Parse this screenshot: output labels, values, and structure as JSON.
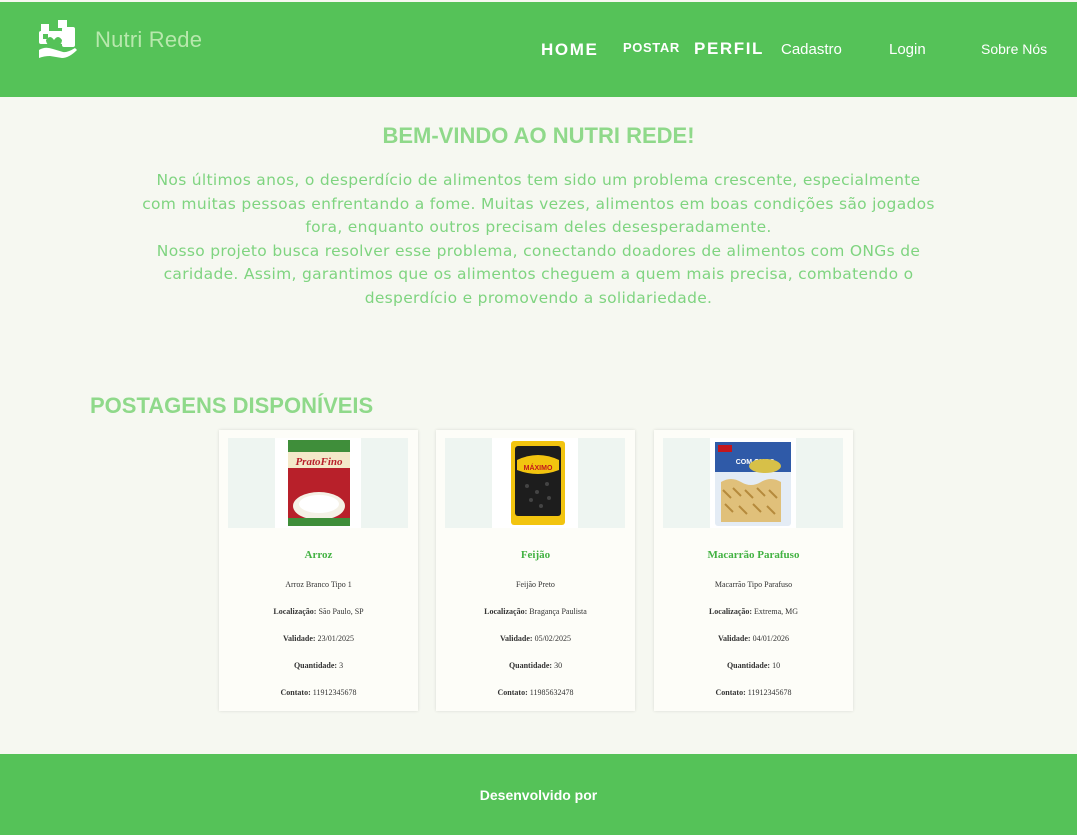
{
  "header": {
    "brand": "Nutri Rede",
    "logo_icon": "hands-heart-icon",
    "nav": {
      "home": "HOME",
      "postar": "POSTAR",
      "perfil": "PERFIL",
      "cadastro": "Cadastro",
      "login": "Login",
      "sobre": "Sobre Nós"
    }
  },
  "welcome": {
    "title": "BEM-VINDO AO NUTRI REDE!",
    "paragraph1": "Nos últimos anos, o desperdício de alimentos tem sido um problema crescente, especialmente com muitas pessoas enfrentando a fome. Muitas vezes, alimentos em boas condições são jogados fora, enquanto outros precisam deles desesperadamente.",
    "paragraph2": "Nosso projeto busca resolver esse problema, conectando doadores de alimentos com ONGs de caridade. Assim, garantimos que os alimentos cheguem a quem mais precisa, combatendo o desperdício e promovendo a solidariedade."
  },
  "posts": {
    "title": "POSTAGENS DISPONÍVEIS",
    "labels": {
      "localizacao": "Localização:",
      "validade": "Validade:",
      "quantidade": "Quantidade:",
      "contato": "Contato:"
    },
    "items": [
      {
        "name": "Arroz",
        "description": "Arroz Branco Tipo 1",
        "location": "São Paulo, SP",
        "validity": "23/01/2025",
        "quantity": "3",
        "contact": "11912345678",
        "image_brand": "PratoFino",
        "image_icon": "rice-package-image"
      },
      {
        "name": "Feijão",
        "description": "Feijão Preto",
        "location": "Bragança Paulista",
        "validity": "05/02/2025",
        "quantity": "30",
        "contact": "11985632478",
        "image_brand": "MÁXIMO",
        "image_icon": "black-beans-package-image"
      },
      {
        "name": "Macarrão Parafuso",
        "description": "Macarrão Tipo Parafuso",
        "location": "Extrema, MG",
        "validity": "04/01/2026",
        "quantity": "10",
        "contact": "11912345678",
        "image_brand": "COM OVOS",
        "image_icon": "pasta-package-image"
      }
    ]
  },
  "footer": {
    "text": "Desenvolvido por"
  },
  "colors": {
    "primary": "#55c258",
    "accent_text": "#8fd98a",
    "card_title": "#43b243",
    "background": "#f6f8f1"
  }
}
